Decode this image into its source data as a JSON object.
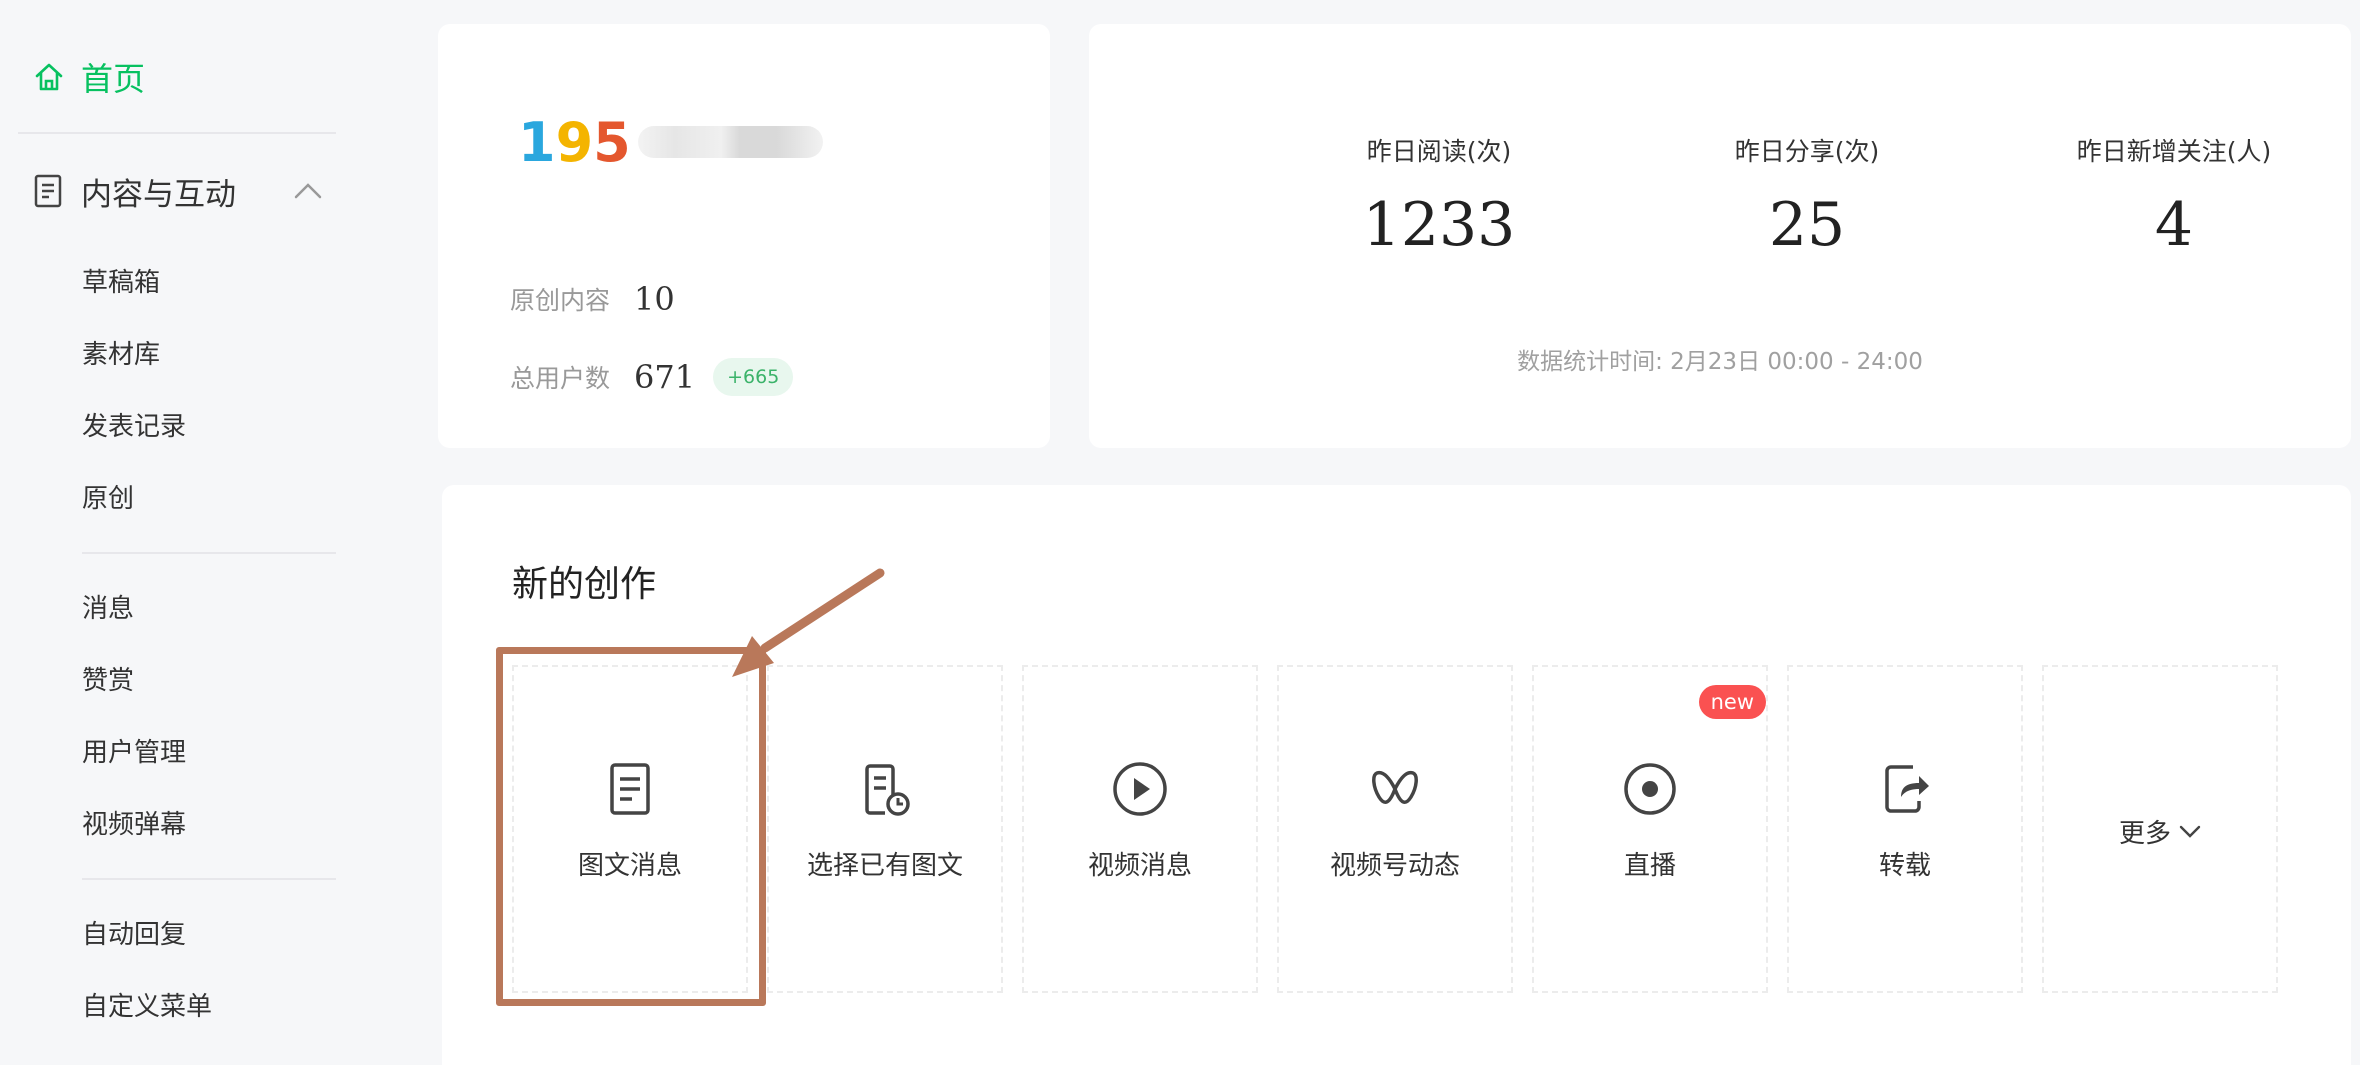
{
  "sidebar": {
    "home_label": "首页",
    "section_label": "内容与互动",
    "group1": [
      "草稿箱",
      "素材库",
      "发表记录",
      "原创"
    ],
    "group2": [
      "消息",
      "赞赏",
      "用户管理",
      "视频弹幕"
    ],
    "group3": [
      "自动回复",
      "自定义菜单"
    ]
  },
  "account": {
    "logo_text": [
      "1",
      "9",
      "5"
    ],
    "original_label": "原创内容",
    "original_value": "10",
    "users_label": "总用户数",
    "users_value": "671",
    "users_delta": "+665"
  },
  "stats": {
    "items": [
      {
        "label": "昨日阅读(次)",
        "value": "1233"
      },
      {
        "label": "昨日分享(次)",
        "value": "25"
      },
      {
        "label": "昨日新增关注(人)",
        "value": "4"
      }
    ],
    "time_note": "数据统计时间: 2月23日 00:00 - 24:00"
  },
  "create": {
    "title": "新的创作",
    "tiles": [
      {
        "label": "图文消息",
        "icon": "article-icon"
      },
      {
        "label": "选择已有图文",
        "icon": "article-clock-icon"
      },
      {
        "label": "视频消息",
        "icon": "play-circle-icon"
      },
      {
        "label": "视频号动态",
        "icon": "channels-icon"
      },
      {
        "label": "直播",
        "icon": "live-icon",
        "badge": "new"
      },
      {
        "label": "转载",
        "icon": "repost-icon"
      }
    ],
    "more_label": "更多"
  },
  "colors": {
    "accent": "#07c160",
    "badge": "#fa5151",
    "annotation": "#b9785a"
  }
}
